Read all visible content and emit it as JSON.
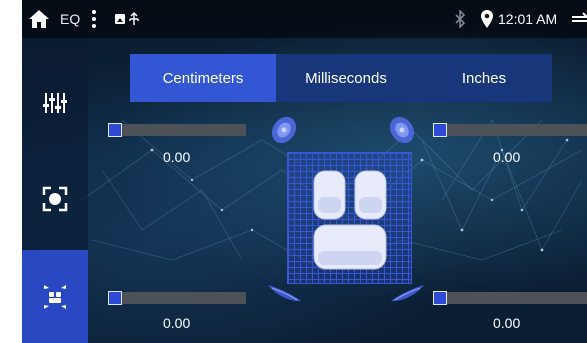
{
  "status_bar": {
    "title": "EQ",
    "time": "12:01 AM",
    "icons": [
      "home-icon",
      "more-vert-icon",
      "notification-icon",
      "bluetooth-icon",
      "location-icon",
      "back-icon"
    ]
  },
  "side_nav": {
    "items": [
      {
        "name": "equalizer",
        "icon": "equalizer-sliders-icon"
      },
      {
        "name": "balance-fader",
        "icon": "speaker-focus-icon"
      },
      {
        "name": "time-alignment",
        "icon": "car-seat-delay-icon"
      }
    ],
    "active": "time-alignment"
  },
  "tabs": [
    {
      "label": "Centimeters",
      "active": true
    },
    {
      "label": "Milliseconds",
      "active": false
    },
    {
      "label": "Inches",
      "active": false
    }
  ],
  "channels": {
    "front_left": {
      "value": "0.00",
      "level": 0
    },
    "front_right": {
      "value": "0.00",
      "level": 0
    },
    "rear_left": {
      "value": "0.00",
      "level": 0
    },
    "rear_right": {
      "value": "0.00",
      "level": 0
    }
  },
  "colors": {
    "accent": "#3356d4",
    "tab_bg": "#18367a",
    "slider_track": "#4d5258",
    "active_nav": "#2a48c2"
  }
}
